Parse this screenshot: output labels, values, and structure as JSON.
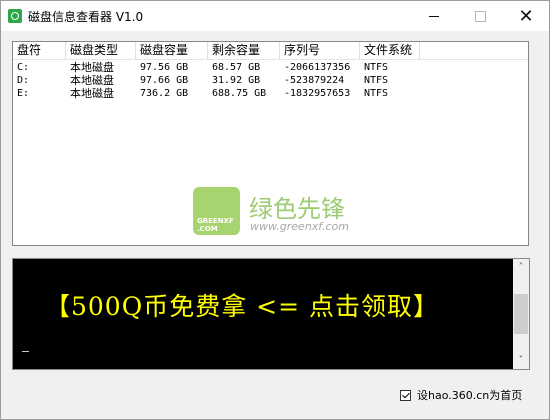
{
  "window": {
    "title": "磁盘信息查看器 V1.0",
    "min_symbol": "",
    "close_symbol": "✕"
  },
  "table": {
    "columns": [
      "盘符",
      "磁盘类型",
      "磁盘容量",
      "剩余容量",
      "序列号",
      "文件系统"
    ],
    "rows": [
      [
        "C:",
        "本地磁盘",
        "97.56 GB",
        "68.57 GB",
        "-2066137356",
        "NTFS"
      ],
      [
        "D:",
        "本地磁盘",
        "97.66 GB",
        "31.92 GB",
        "-523879224",
        "NTFS"
      ],
      [
        "E:",
        "本地磁盘",
        "736.2 GB",
        "688.75 GB",
        "-1832957653",
        "NTFS"
      ]
    ]
  },
  "watermark": {
    "logo_text": "GREENXF\n.COM",
    "brand_cn": "绿色先锋",
    "url": "www.greenxf.com"
  },
  "ad": {
    "text": "【500Q币免费拿 <= 点击领取】",
    "text_color": "#ffff00",
    "background": "#000000"
  },
  "homepage_option": {
    "label": "设hao.360.cn为首页",
    "checked": true
  },
  "colors": {
    "app_icon": "#2ca84a",
    "watermark_green": "#7dba45"
  }
}
